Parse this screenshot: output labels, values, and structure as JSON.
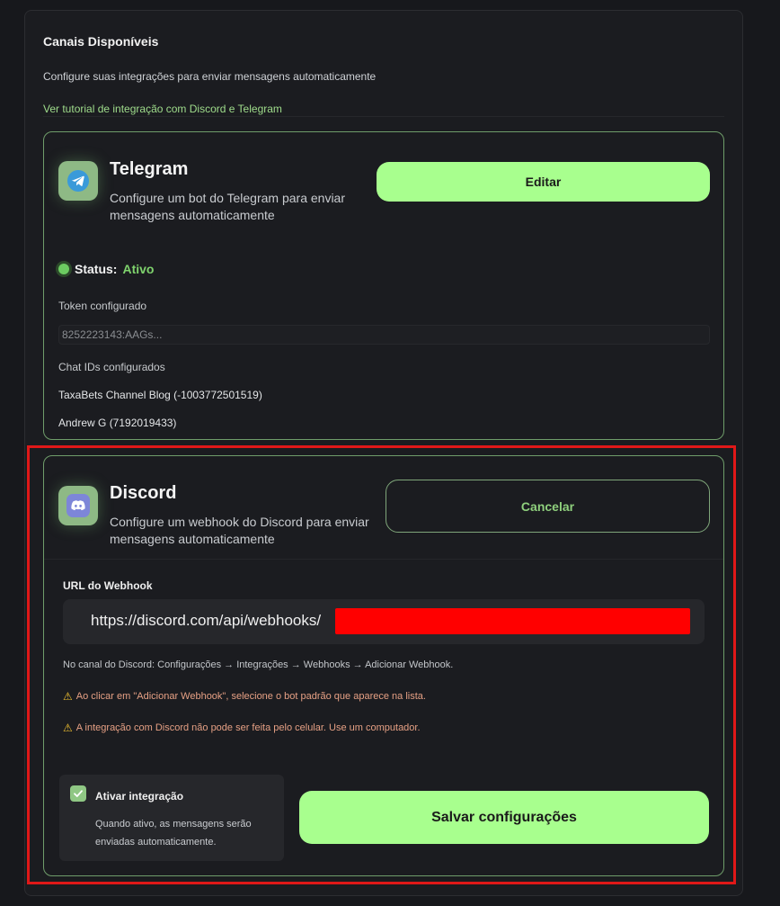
{
  "header": {
    "title": "Canais Disponíveis",
    "subtitle": "Configure suas integrações para enviar mensagens automaticamente",
    "tutorial_link": "Ver tutorial de integração com Discord e Telegram"
  },
  "telegram": {
    "title": "Telegram",
    "description": "Configure um bot do Telegram para enviar mensagens automaticamente",
    "edit_label": "Editar",
    "status_label": "Status:",
    "status_value": "Ativo",
    "token_label": "Token configurado",
    "token_value": "8252223143:AAGs...",
    "chat_ids_label": "Chat IDs configurados",
    "chat_ids": [
      "TaxaBets Channel Blog (-1003772501519)",
      "Andrew G (7192019433)"
    ]
  },
  "discord": {
    "title": "Discord",
    "description": "Configure um webhook do Discord para enviar mensagens automaticamente",
    "cancel_label": "Cancelar",
    "webhook_label": "URL do Webhook",
    "webhook_url": "https://discord.com/api/webhooks/",
    "hint": "No canal do Discord: Configurações → Integrações → Webhooks → Adicionar Webhook.",
    "warnings": [
      "Ao clicar em \"Adicionar Webhook\", selecione o bot padrão que aparece na lista.",
      "A integração com Discord não pode ser feita pelo celular. Use um computador."
    ],
    "toggle_title": "Ativar integração",
    "toggle_desc": "Quando ativo, as mensagens serão enviadas automaticamente.",
    "toggle_checked": true,
    "save_label": "Salvar configurações"
  },
  "colors": {
    "accent": "#a8ff8e",
    "status_active": "#7fd36d",
    "warning": "#e6a084",
    "highlight": "#e01818"
  },
  "icons": {
    "telegram": "telegram-icon",
    "discord": "discord-icon",
    "warning": "warning-icon",
    "check": "check-icon"
  }
}
